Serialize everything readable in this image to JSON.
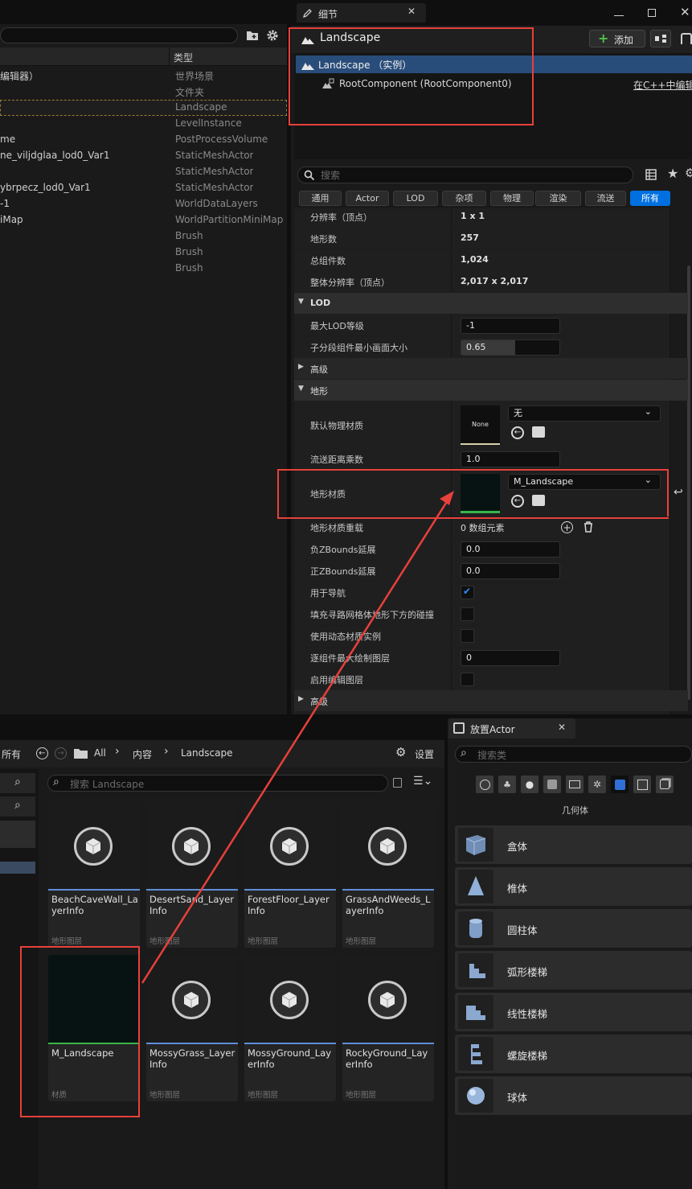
{
  "outliner": {
    "type_header": "类型",
    "rows": [
      {
        "name": "编辑器）",
        "type": "世界场景"
      },
      {
        "name": "",
        "type": "文件夹"
      },
      {
        "name": "",
        "type": "Landscape"
      },
      {
        "name": "",
        "type": "LevelInstance"
      },
      {
        "name": "me",
        "type": "PostProcessVolume"
      },
      {
        "name": "ne_viljdglaa_lod0_Var1",
        "type": "StaticMeshActor"
      },
      {
        "name": "",
        "type": "StaticMeshActor"
      },
      {
        "name": "ybrpecz_lod0_Var1",
        "type": "StaticMeshActor"
      },
      {
        "name": "-1",
        "type": "WorldDataLayers"
      },
      {
        "name": "iMap",
        "type": "WorldPartitionMiniMap"
      },
      {
        "name": "",
        "type": "Brush"
      },
      {
        "name": "",
        "type": "Brush"
      },
      {
        "name": "",
        "type": "Brush"
      }
    ]
  },
  "details": {
    "tab_title": "细节",
    "actor_name": "Landscape",
    "add_label": "添加",
    "instance_label": "Landscape （实例）",
    "root_component": "RootComponent (RootComponent0)",
    "edit_cpp": "在C++中编辑",
    "search_placeholder": "搜索",
    "filters": [
      "通用",
      "Actor",
      "LOD",
      "杂项",
      "物理",
      "渲染",
      "流送",
      "所有"
    ],
    "rows": {
      "resolution": {
        "label": "分辨率（顶点）",
        "value": "1 x 1"
      },
      "num_components": {
        "label": "地形数",
        "value": "257"
      },
      "total_components": {
        "label": "总组件数",
        "value": "1,024"
      },
      "overall_resolution": {
        "label": "整体分辨率（顶点）",
        "value": "2,017 x 2,017"
      }
    },
    "lod_section": "LOD",
    "max_lod": {
      "label": "最大LOD等级",
      "value": "-1"
    },
    "lod_screen_size": {
      "label": "子分段组件最小画面大小",
      "value": "0.65",
      "fill": 0.55
    },
    "advanced": "高级",
    "landscape_section": "地形",
    "default_phys_mat": {
      "label": "默认物理材质",
      "thumb": "None",
      "value": "无"
    },
    "streaming_dist": {
      "label": "流送距离乘数",
      "value": "1.0"
    },
    "landscape_material": {
      "label": "地形材质",
      "value": "M_Landscape"
    },
    "material_override": {
      "label": "地形材质重载",
      "value": "0 数组元素"
    },
    "neg_z": {
      "label": "负ZBounds延展",
      "value": "0.0"
    },
    "pos_z": {
      "label": "正ZBounds延展",
      "value": "0.0"
    },
    "used_for_nav": {
      "label": "用于导航",
      "checked": true
    },
    "fill_collision": {
      "label": "填充寻路网格体地形下方的碰撞",
      "checked": false
    },
    "dynamic_mat": {
      "label": "使用动态材质实例",
      "checked": false
    },
    "max_paint_layers": {
      "label": "逐组件最大绘制图层",
      "value": "0"
    },
    "edit_layers": {
      "label": "启用编辑图层",
      "checked": false
    },
    "advanced2": "高级"
  },
  "content_browser": {
    "all_label": "所有",
    "breadcrumb": [
      "All",
      "内容",
      "Landscape"
    ],
    "settings_label": "设置",
    "search_placeholder": "搜索 Landscape",
    "assets": [
      {
        "name": "BeachCaveWall_LayerInfo",
        "type": "地形图层"
      },
      {
        "name": "DesertSand_Layer Info",
        "type": "地形图层"
      },
      {
        "name": "ForestFloor_Layer Info",
        "type": "地形图层"
      },
      {
        "name": "GrassAndWeeds_LayerInfo",
        "type": "地形图层"
      },
      {
        "name": "M_Landscape",
        "type": "材质"
      },
      {
        "name": "MossyGrass_Layer Info",
        "type": "地形图层"
      },
      {
        "name": "MossyGround_LayerInfo",
        "type": "地形图层"
      },
      {
        "name": "RockyGround_LayerInfo",
        "type": "地形图层"
      }
    ]
  },
  "place_actor": {
    "title": "放置Actor",
    "search_placeholder": "搜索类",
    "category_label": "几何体",
    "items": [
      "盒体",
      "椎体",
      "圆柱体",
      "弧形楼梯",
      "线性楼梯",
      "螺旋楼梯",
      "球体"
    ]
  },
  "colors": {
    "accent": "#0070e0",
    "highlight": "#e8403a",
    "selection": "#294d7a",
    "material_bar": "#39b54a"
  }
}
